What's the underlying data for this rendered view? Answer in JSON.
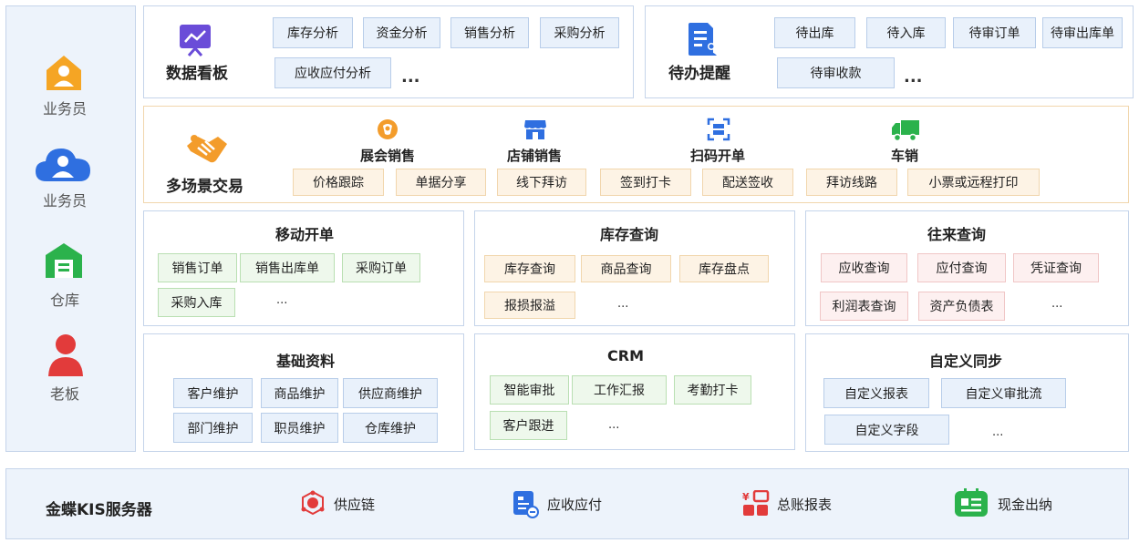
{
  "roles": [
    {
      "label": "业务员",
      "icon": "user-house-icon",
      "color": "#f5a524"
    },
    {
      "label": "业务员",
      "icon": "user-cloud-icon",
      "color": "#2f6fe0"
    },
    {
      "label": "仓库",
      "icon": "warehouse-icon",
      "color": "#2bb24c"
    },
    {
      "label": "老板",
      "icon": "boss-person-icon",
      "color": "#e23b3b"
    }
  ],
  "dashboard": {
    "title": "数据看板",
    "icon": "monitor-chart-icon",
    "tags": [
      "库存分析",
      "资金分析",
      "销售分析",
      "采购分析",
      "应收应付分析"
    ],
    "more": "..."
  },
  "todo": {
    "title": "待办提醒",
    "icon": "document-user-icon",
    "tags": [
      "待出库",
      "待入库",
      "待审订单",
      "待审出库单",
      "待审收款"
    ],
    "more": "..."
  },
  "multi_scene": {
    "title": "多场景交易",
    "icon": "handshake-icon",
    "scenes": [
      {
        "label": "展会销售",
        "icon": "exhibition-icon"
      },
      {
        "label": "店铺销售",
        "icon": "store-icon"
      },
      {
        "label": "扫码开单",
        "icon": "scan-icon"
      },
      {
        "label": "车销",
        "icon": "truck-icon"
      }
    ],
    "tags": [
      "价格跟踪",
      "单据分享",
      "线下拜访",
      "签到打卡",
      "配送签收",
      "拜访线路",
      "小票或远程打印"
    ]
  },
  "mobile_order": {
    "title": "移动开单",
    "tags": [
      "销售订单",
      "销售出库单",
      "采购订单",
      "采购入库"
    ],
    "more": "..."
  },
  "stock_query": {
    "title": "库存查询",
    "tags": [
      "库存查询",
      "商品查询",
      "库存盘点",
      "报损报溢"
    ],
    "more": "..."
  },
  "account_query": {
    "title": "往来查询",
    "tags": [
      "应收查询",
      "应付查询",
      "凭证查询",
      "利润表查询",
      "资产负债表"
    ],
    "more": "..."
  },
  "basic_data": {
    "title": "基础资料",
    "tags": [
      "客户维护",
      "商品维护",
      "供应商维护",
      "部门维护",
      "职员维护",
      "仓库维护"
    ]
  },
  "crm": {
    "title": "CRM",
    "tags": [
      "智能审批",
      "工作汇报",
      "考勤打卡",
      "客户跟进"
    ],
    "more": "..."
  },
  "custom_sync": {
    "title": "自定义同步",
    "tags": [
      "自定义报表",
      "自定义审批流",
      "自定义字段"
    ],
    "more": "..."
  },
  "server": {
    "title": "金蝶KIS服务器",
    "services": [
      {
        "label": "供应链",
        "icon": "supply-chain-icon"
      },
      {
        "label": "应收应付",
        "icon": "receivable-icon"
      },
      {
        "label": "总账报表",
        "icon": "ledger-report-icon"
      },
      {
        "label": "现金出纳",
        "icon": "cashier-icon"
      }
    ]
  },
  "colors": {
    "blue_tag": "#e9f1fb",
    "orange_tag": "#fdf3e5",
    "green_tag": "#eef8ec",
    "pink_tag": "#fdf0f0",
    "panel_border": "#c5d4ea"
  }
}
